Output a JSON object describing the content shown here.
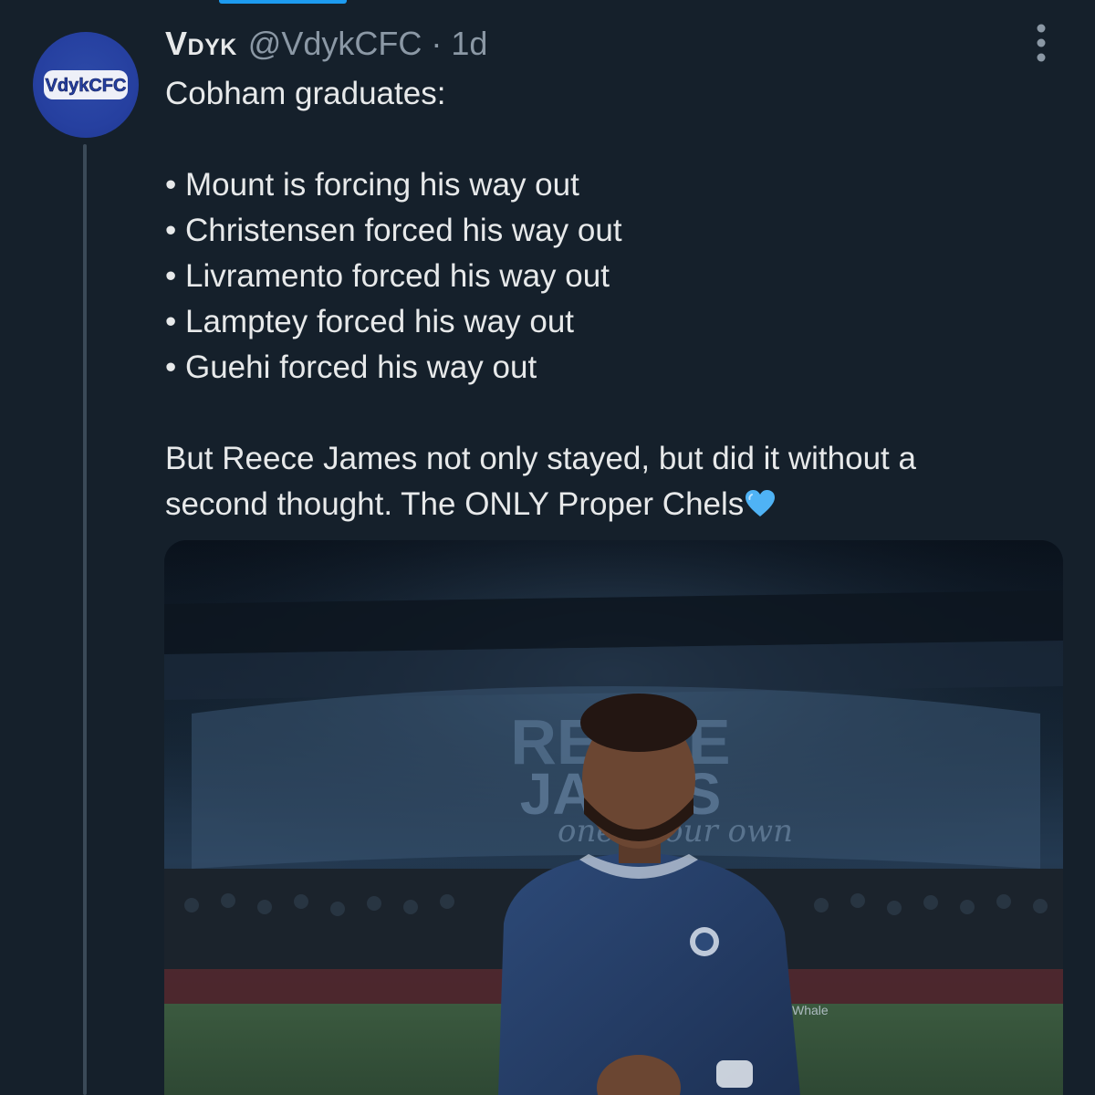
{
  "tweet": {
    "display_name": "Vdyk",
    "handle": "@VdykCFC",
    "separator": "·",
    "time": "1d",
    "avatar_text": "VdykCFC",
    "intro": "Cobham graduates:",
    "bullets": [
      "• Mount is forcing his way out",
      "• Christensen forced his way out",
      "• Livramento forced his way out",
      "• Lamptey forced his way out",
      "• Guehi forced his way out"
    ],
    "closing_line_1": "But Reece James not only stayed, but did it without a",
    "closing_line_2": "second thought. The ONLY Proper Chels",
    "closing_emoji": "blue-heart-icon",
    "media": {
      "description": "photo",
      "banner_text_1": "REECE",
      "banner_text_2": "JAMES",
      "banner_text_3": "one of our own",
      "sponsor_text": "Whale"
    }
  },
  "colors": {
    "background": "#15202b",
    "text_primary": "#e7e9ea",
    "text_secondary": "#8b98a5",
    "accent": "#1d9bf0",
    "avatar_bg": "#2640a0",
    "heart": "#4fb3f5"
  },
  "icons": {
    "more": "more-vertical-icon",
    "emoji": "blue-heart-icon"
  }
}
